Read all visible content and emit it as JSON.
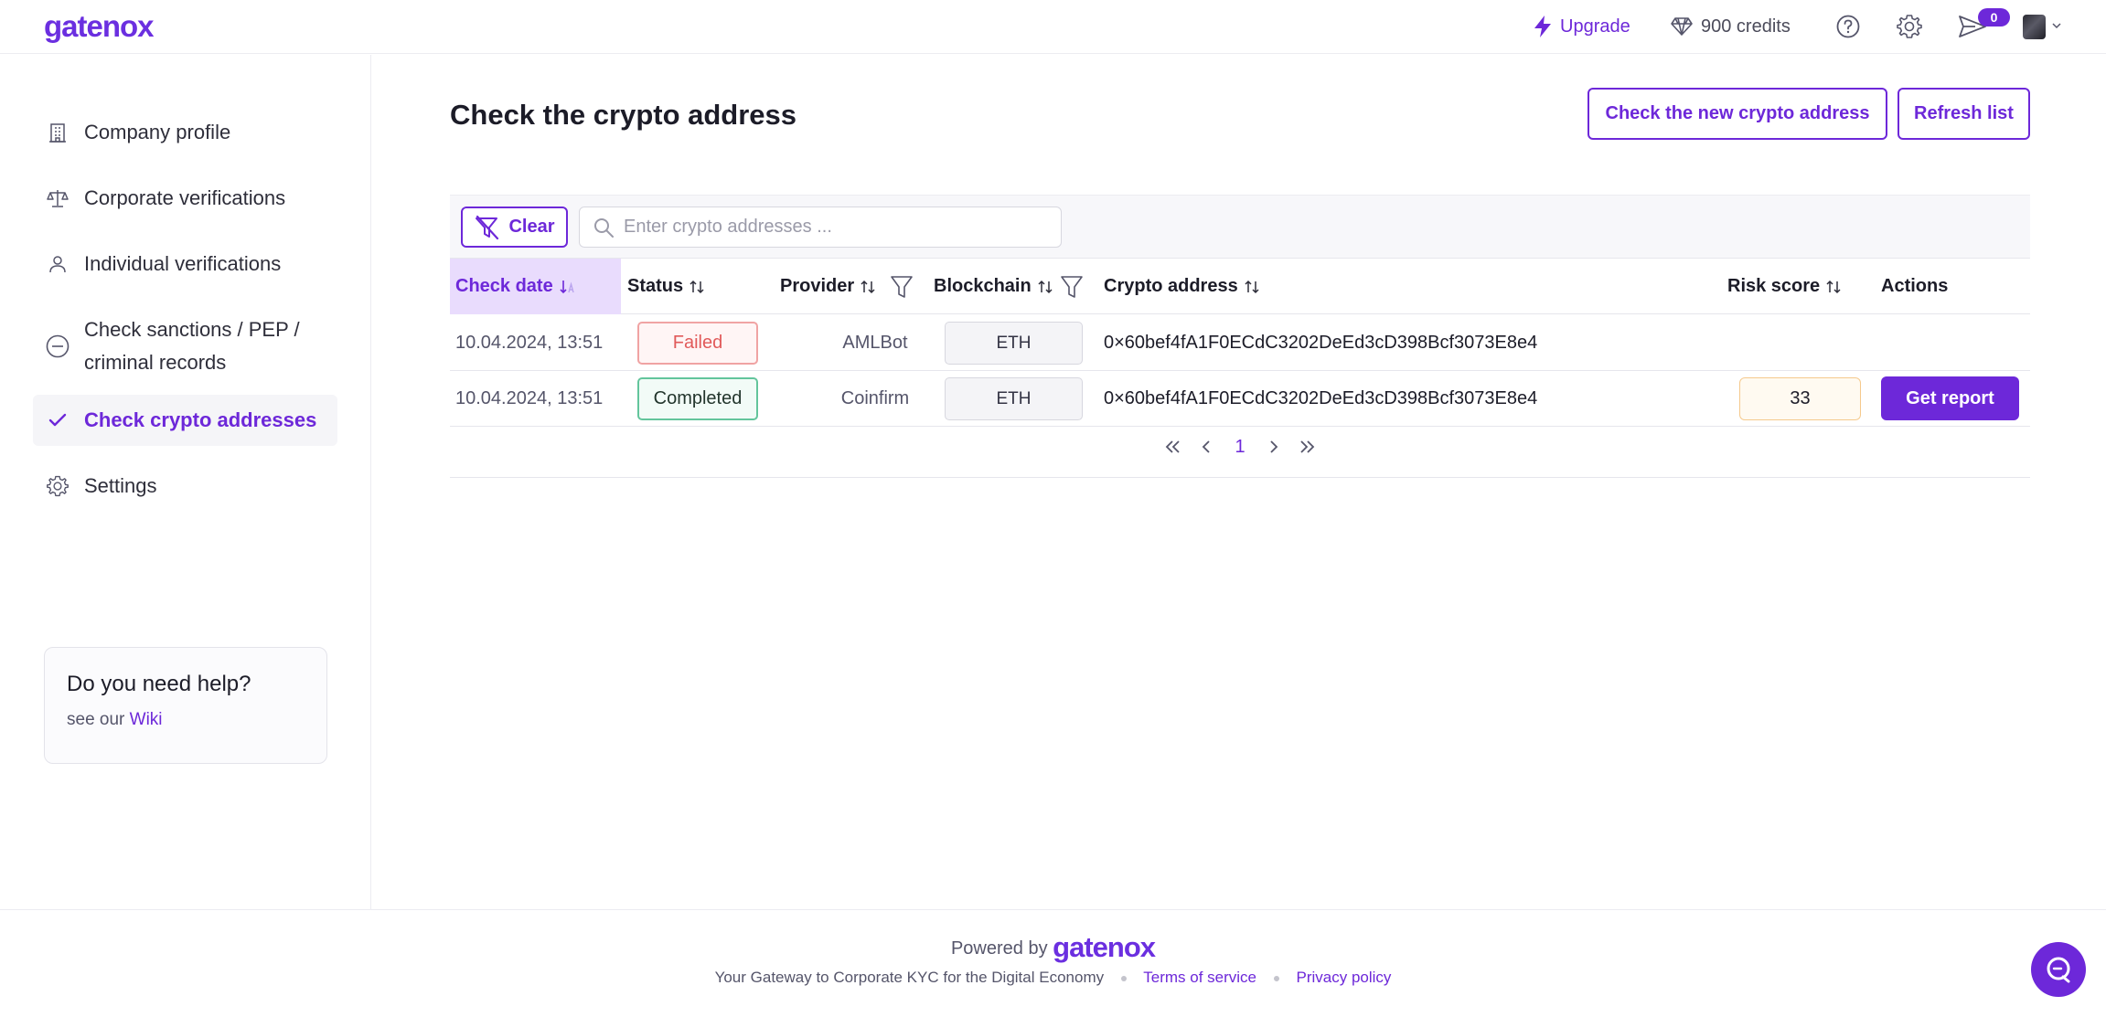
{
  "header": {
    "logo": "gatenox",
    "upgrade_label": "Upgrade",
    "credits_label": "900 credits",
    "notifications_count": "0",
    "icons": [
      "lightning-icon",
      "diamond-icon",
      "help-icon",
      "gear-icon",
      "send-icon",
      "avatar",
      "chevron-down-icon"
    ]
  },
  "sidebar": {
    "items": [
      {
        "label": "Company profile",
        "icon": "building-icon"
      },
      {
        "label": "Corporate verifications",
        "icon": "scales-icon"
      },
      {
        "label": "Individual verifications",
        "icon": "person-icon"
      },
      {
        "label": "Check sanctions / PEP / criminal records",
        "icon": "minus-circle-icon"
      },
      {
        "label": "Check crypto addresses",
        "icon": "check-icon",
        "active": true
      },
      {
        "label": "Settings",
        "icon": "gear-icon"
      }
    ],
    "help": {
      "title": "Do you need help?",
      "prefix": "see our",
      "link": "Wiki"
    }
  },
  "main": {
    "title": "Check the crypto address",
    "new_button": "Check the new crypto address",
    "refresh_button": "Refresh list",
    "clear_button": "Clear",
    "search_placeholder": "Enter crypto addresses ...",
    "columns": [
      "Check date",
      "Status",
      "Provider",
      "Blockchain",
      "Crypto address",
      "Risk score",
      "Actions"
    ],
    "rows": [
      {
        "date": "10.04.2024, 13:51",
        "status": "Failed",
        "provider": "AMLBot",
        "blockchain": "ETH",
        "address": "0×60bef4fA1F0ECdC3202DeEd3cD398Bcf3073E8e4",
        "risk": "",
        "action": ""
      },
      {
        "date": "10.04.2024, 13:51",
        "status": "Completed",
        "provider": "Coinfirm",
        "blockchain": "ETH",
        "address": "0×60bef4fA1F0ECdC3202DeEd3cD398Bcf3073E8e4",
        "risk": "33",
        "action": "Get report"
      }
    ],
    "pagination": {
      "current_page": "1"
    }
  },
  "footer": {
    "powered_by": "Powered by",
    "brand": "gatenox",
    "tagline": "Your Gateway to Corporate KYC for the Digital Economy",
    "terms": "Terms of service",
    "privacy": "Privacy policy"
  },
  "colors": {
    "accent": "#6d28d9",
    "failed": "#e15a5a",
    "completed": "#63c59c",
    "risk_border": "#f5c98c"
  }
}
